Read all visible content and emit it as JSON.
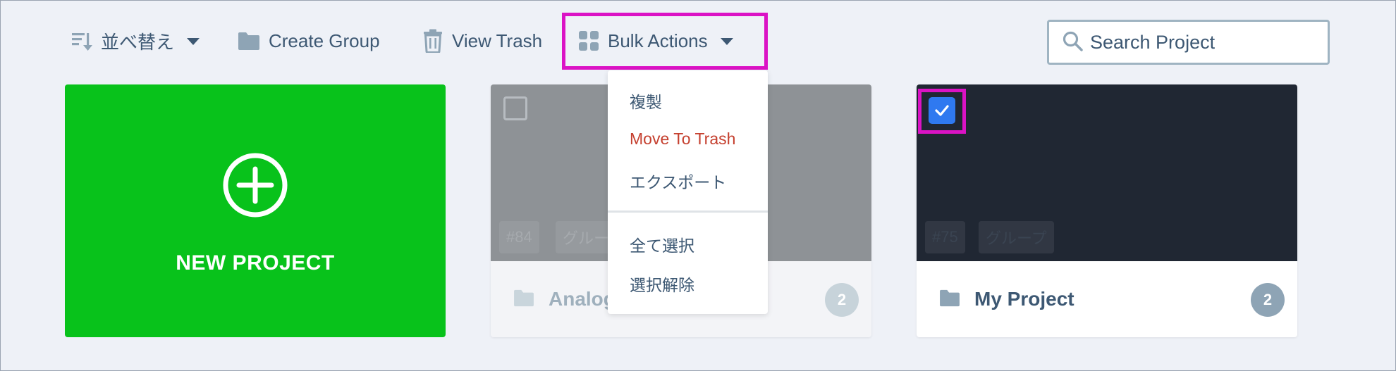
{
  "toolbar": {
    "sort_label": "並べ替え",
    "create_group_label": "Create Group",
    "view_trash_label": "View Trash",
    "bulk_actions_label": "Bulk Actions"
  },
  "search": {
    "placeholder": "Search Project"
  },
  "new_project": {
    "label": "NEW PROJECT"
  },
  "bulk_menu": {
    "items": [
      "複製",
      "Move To Trash",
      "エクスポート"
    ],
    "selection_items": [
      "全て選択",
      "選択解除"
    ]
  },
  "projects": [
    {
      "name": "Analog",
      "count": "2",
      "tags": [
        "#84",
        "グループ"
      ],
      "selected": false
    },
    {
      "name": "My Project",
      "count": "2",
      "tags": [
        "#75",
        "グループ"
      ],
      "selected": true
    }
  ],
  "colors": {
    "accent_green": "#08c21b",
    "highlight_magenta": "#db13c5",
    "checkbox_blue": "#2f79f0",
    "danger_red": "#c5402f"
  }
}
